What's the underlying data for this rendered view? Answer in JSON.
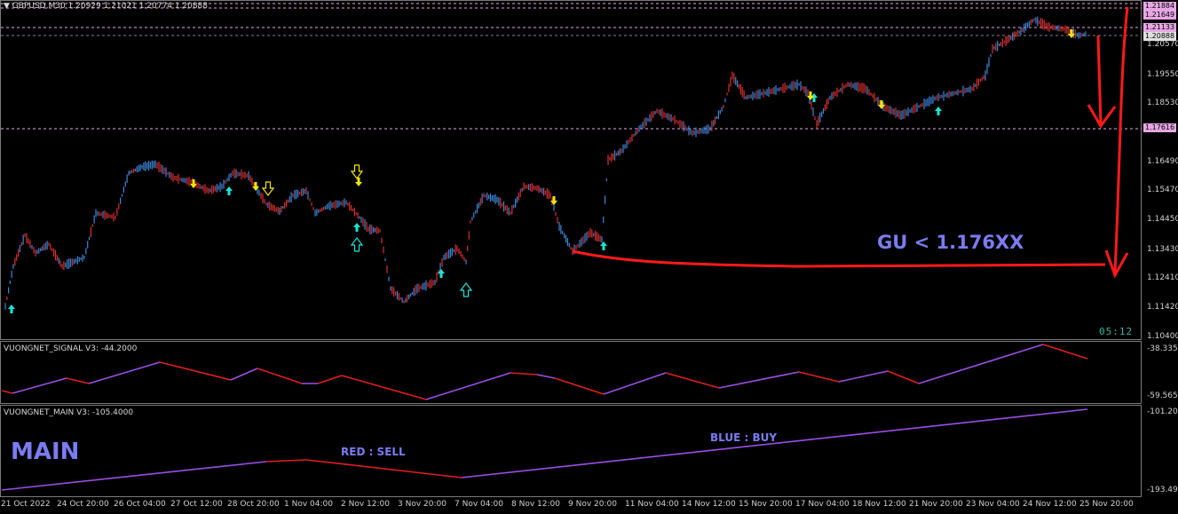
{
  "main_chart": {
    "title": "GBPUSD,M30  1.20929 1.21021 1.20774 1.20888",
    "price_axis": [
      "1.20570",
      "1.19550",
      "1.18530",
      "1.16490",
      "1.15470",
      "1.14450",
      "1.13430",
      "1.12410",
      "1.11420",
      "1.10400"
    ],
    "price_tags": [
      "1.21884",
      "1.21649",
      "1.21133",
      "1.20888",
      "1.17616"
    ],
    "annotation": "GU < 1.176XX",
    "timer": "05:12",
    "colors": {
      "candles": "#3d86d8",
      "bear": "#d93030",
      "arrow_sell": "#f2e600",
      "arrow_buy": "#19e6d6",
      "annot_red": "#ff1a1a",
      "annot_text": "#7b7bf2"
    }
  },
  "signal_panel": {
    "title": "VUONGNET_SIGNAL V3:  -44.2000",
    "axis": [
      "-38.335",
      "-59.565"
    ]
  },
  "main_panel": {
    "title": "VUONGNET_MAIN V3:  -105.4000",
    "axis": [
      "-101.205",
      "-193.495"
    ],
    "label_main": "MAIN",
    "label_sell": "RED : SELL",
    "label_buy": "BLUE : BUY"
  },
  "time_axis": [
    "21 Oct 2022",
    "24 Oct 20:00",
    "26 Oct 04:00",
    "27 Oct 12:00",
    "28 Oct 20:00",
    "1 Nov 04:00",
    "2 Nov 12:00",
    "3 Nov 20:00",
    "7 Nov 04:00",
    "8 Nov 12:00",
    "9 Nov 20:00",
    "11 Nov 04:00",
    "14 Nov 12:00",
    "15 Nov 20:00",
    "17 Nov 04:00",
    "18 Nov 12:00",
    "21 Nov 20:00",
    "23 Nov 04:00",
    "24 Nov 12:00",
    "25 Nov 20:00"
  ]
}
